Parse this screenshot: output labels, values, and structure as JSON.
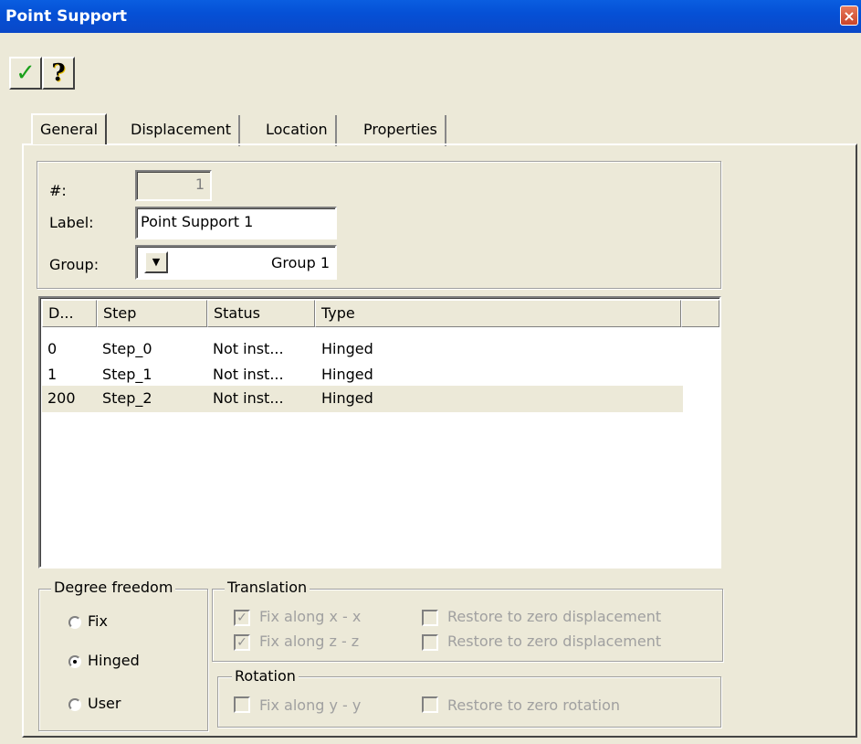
{
  "window": {
    "title": "Point Support",
    "close_glyph": "×"
  },
  "toolbar": {
    "ok_icon": "✓",
    "help_icon": "?"
  },
  "tabs": [
    {
      "label": "General",
      "active": true
    },
    {
      "label": "Displacement"
    },
    {
      "label": "Location"
    },
    {
      "label": "Properties"
    }
  ],
  "general": {
    "number_label": "#:",
    "number_value": "1",
    "label_label": "Label:",
    "label_value": "Point Support 1",
    "group_label": "Group:",
    "group_value": "Group 1",
    "group_dropdown_glyph": "▼"
  },
  "list": {
    "columns": [
      "D...",
      "Step",
      "Status",
      "Type"
    ],
    "rows": [
      {
        "d": "0",
        "step": "Step_0",
        "status": "Not inst...",
        "type": "Hinged"
      },
      {
        "d": "1",
        "step": "Step_1",
        "status": "Not inst...",
        "type": "Hinged"
      },
      {
        "d": "200",
        "step": "Step_2",
        "status": "Not inst...",
        "type": "Hinged",
        "selected": true
      }
    ]
  },
  "degree_freedom": {
    "title": "Degree freedom",
    "options": [
      "Fix",
      "Hinged",
      "User"
    ],
    "selected": "Hinged"
  },
  "translation": {
    "title": "Translation",
    "fix_x": {
      "label": "Fix along x - x",
      "checked": true
    },
    "fix_z": {
      "label": "Fix along z - z",
      "checked": true
    },
    "restore_1": {
      "label": "Restore to zero displacement",
      "checked": false
    },
    "restore_2": {
      "label": "Restore to zero displacement",
      "checked": false
    }
  },
  "rotation": {
    "title": "Rotation",
    "fix_y": {
      "label": "Fix along y - y",
      "checked": false
    },
    "restore": {
      "label": "Restore to zero rotation",
      "checked": false
    }
  },
  "colors": {
    "titlebar": "#0550d6",
    "selection": "#ece9d8",
    "ok_green": "#1aa01a"
  }
}
